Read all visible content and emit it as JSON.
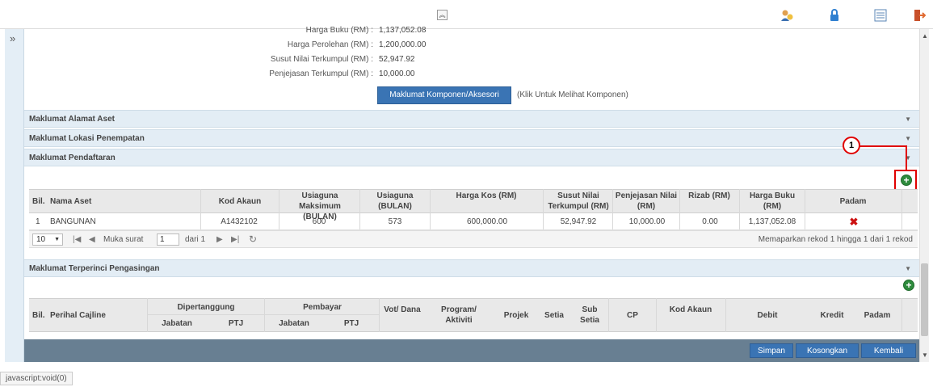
{
  "toolbar": {
    "collapse_icon": "double-chevron-up-icon",
    "icons": [
      "user-help-icon",
      "lock-icon",
      "list-view-icon",
      "logout-icon"
    ]
  },
  "sidebar": {
    "toggle_glyph": "»"
  },
  "summary": {
    "rows": [
      {
        "label": "Harga Buku (RM) :",
        "value": "1,137,052.08"
      },
      {
        "label": "Harga Perolehan (RM) :",
        "value": "1,200,000.00"
      },
      {
        "label": "Susut Nilai Terkumpul (RM) :",
        "value": "52,947.92"
      },
      {
        "label": "Penjejasan Terkumpul (RM) :",
        "value": "10,000.00"
      }
    ],
    "component_button": "Maklumat Komponen/Aksesori",
    "component_hint": "(Klik Untuk Melihat Komponen)"
  },
  "sections": {
    "alamat": "Maklumat Alamat Aset",
    "lokasi": "Maklumat Lokasi Penempatan",
    "pendaftaran": "Maklumat Pendaftaran",
    "pengasingan": "Maklumat Terperinci Pengasingan"
  },
  "asset_table": {
    "headers": [
      "Bil.",
      "Nama Aset",
      "Kod Akaun",
      "Usiaguna Maksimum (BULAN)",
      "Usiaguna (BULAN)",
      "Harga Kos (RM)",
      "Susut Nilai Terkumpul (RM)",
      "Penjejasan Nilai (RM)",
      "Rizab (RM)",
      "Harga Buku (RM)",
      "Padam"
    ],
    "rows": [
      [
        "1",
        "BANGUNAN",
        "A1432102",
        "600",
        "573",
        "600,000.00",
        "52,947.92",
        "10,000.00",
        "0.00",
        "1,137,052.08",
        "✖"
      ]
    ]
  },
  "pager": {
    "page_size": "10",
    "page_label": "Muka surat",
    "page_value": "1",
    "of_label": "dari 1",
    "summary": "Memaparkan rekod 1 hingga 1 dari 1 rekod"
  },
  "callout_number": "1",
  "cajline_table": {
    "bil": "Bil.",
    "perihal": "Perihal Cajline",
    "dipertanggung": "Dipertanggung",
    "pembayar": "Pembayar",
    "jabatan1": "Jabatan",
    "ptj1": "PTJ",
    "jabatan2": "Jabatan",
    "ptj2": "PTJ",
    "vot": "Vot/ Dana",
    "program": "Program/ Aktiviti",
    "projek": "Projek",
    "setia": "Setia",
    "subsetia": "Sub Setia",
    "cp": "CP",
    "kodakaun": "Kod Akaun",
    "debit": "Debit",
    "kredit": "Kredit",
    "padam": "Padam"
  },
  "footer": {
    "simpan": "Simpan",
    "kosongkan": "Kosongkan",
    "kembali": "Kembali"
  },
  "status_url": "javascript:void(0)",
  "colors": {
    "accent": "#3a74b4",
    "section_bg": "#e3edf5",
    "footer_bg": "#687f92",
    "highlight": "#e00000",
    "add_green": "#2e8b3d"
  }
}
